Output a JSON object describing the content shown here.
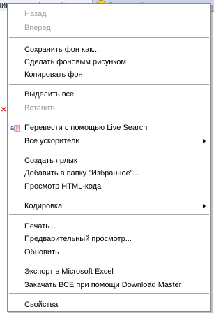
{
  "background": {
    "tab_left_text": "Прикольное фото:: На...",
    "tab_right_text": "Очаков, Черноморская..."
  },
  "menu": {
    "back": "Назад",
    "forward": "Вперед",
    "save_background": "Сохранить фон как...",
    "set_wallpaper": "Сделать фоновым рисунком",
    "copy_background": "Копировать фон",
    "select_all": "Выделить все",
    "paste": "Вставить",
    "translate": "Перевести с помощью Live Search",
    "accelerators": "Все ускорители",
    "create_shortcut": "Создать ярлык",
    "add_favorites": "Добавить в папку \"Избранное\"...",
    "view_source": "Просмотр HTML-кода",
    "encoding": "Кодировка",
    "print": "Печать...",
    "print_preview": "Предварительный просмотр...",
    "refresh": "Обновить",
    "export_excel": "Экспорт в Microsoft Excel",
    "download_master": "Закачать ВСЕ при помощи Download Master",
    "properties": "Свойства"
  },
  "icons": {
    "translate_icon": "live-search-translate-icon",
    "submenu_arrow": "submenu-arrow-icon"
  },
  "colors": {
    "disabled_text": "#a0a0a0",
    "separator": "#a7a7a7"
  }
}
